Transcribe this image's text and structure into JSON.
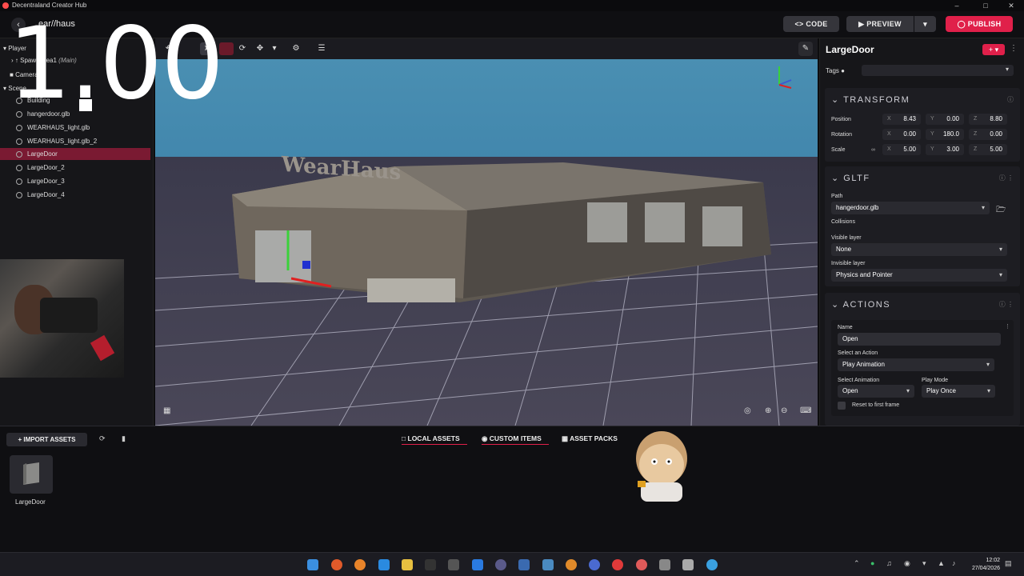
{
  "app": {
    "title": "Decentraland Creator Hub",
    "project_title": "ear//haus",
    "overlay_number": "1.00"
  },
  "header": {
    "code_label": "CODE",
    "preview_label": "PREVIEW",
    "publish_label": "PUBLISH"
  },
  "left_panel": {
    "player_label": "Player",
    "spawn_area": "SpawnArea1",
    "spawn_main": "(Main)",
    "camera_label": "Camera",
    "scene_label": "Scene",
    "items": [
      {
        "label": "Building"
      },
      {
        "label": "hangerdoor.glb"
      },
      {
        "label": "WEARHAUS_light.glb"
      },
      {
        "label": "WEARHAUS_light.glb_2"
      },
      {
        "label": "LargeDoor"
      },
      {
        "label": "LargeDoor_2"
      },
      {
        "label": "LargeDoor_3"
      },
      {
        "label": "LargeDoor_4"
      }
    ],
    "selected": "LargeDoor"
  },
  "inspector": {
    "entity_name": "LargeDoor",
    "tags_label": "Tags",
    "transform": {
      "title": "TRANSFORM",
      "position_label": "Position",
      "rotation_label": "Rotation",
      "scale_label": "Scale",
      "position": {
        "x": "8.43",
        "y": "0.00",
        "z": "8.80"
      },
      "rotation": {
        "x": "0.00",
        "y": "180.0",
        "z": "0.00"
      },
      "scale": {
        "x": "5.00",
        "y": "3.00",
        "z": "5.00"
      }
    },
    "gltf": {
      "title": "GLTF",
      "path_label": "Path",
      "path_value": "hangerdoor.glb",
      "collisions_label": "Collisions",
      "visible_layer_label": "Visible layer",
      "visible_layer_value": "None",
      "invisible_layer_label": "Invisible layer",
      "invisible_layer_value": "Physics and Pointer"
    },
    "actions": {
      "title": "ACTIONS",
      "name_label": "Name",
      "name_value": "Open",
      "select_action_label": "Select an Action",
      "select_action_value": "Play Animation",
      "select_animation_label": "Select Animation",
      "select_animation_value": "Open",
      "play_mode_label": "Play Mode",
      "play_mode_value": "Play Once",
      "reset_label": "Reset to first frame"
    }
  },
  "assets": {
    "import_label": "IMPORT ASSETS",
    "tabs": [
      "LOCAL ASSETS",
      "CUSTOM ITEMS",
      "ASSET PACKS"
    ],
    "items": [
      {
        "label": "LargeDoor"
      }
    ]
  },
  "viewport": {
    "sign_text": "WearHaus"
  },
  "taskbar": {
    "time": "12:02",
    "date": "27/04/2026"
  },
  "colors": {
    "accent": "#e0204a",
    "sky": "#4a8fb2",
    "selected_row": "#7a1a32"
  }
}
